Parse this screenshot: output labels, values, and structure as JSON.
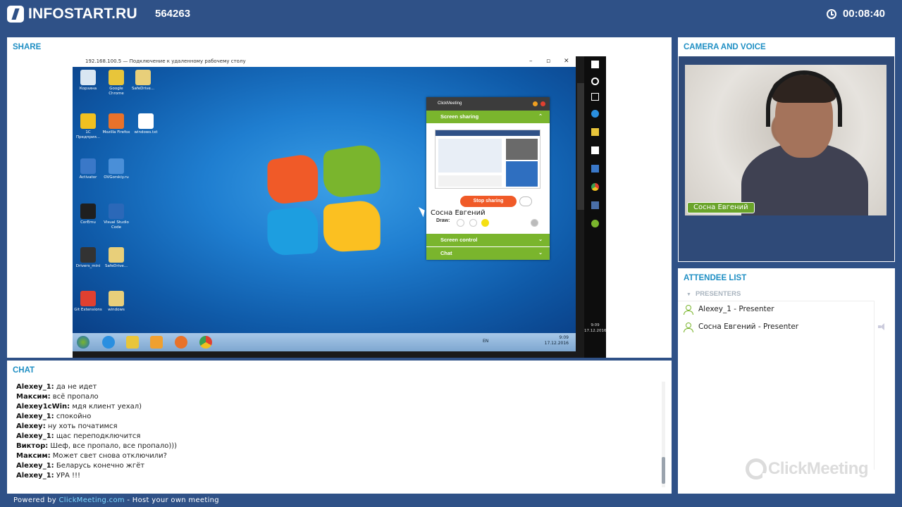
{
  "header": {
    "logo_text": "INFOSTART.RU",
    "meeting_id": "564263",
    "timer": "00:08:40"
  },
  "share": {
    "title": "SHARE",
    "remote_title": "192.168.100.5 — Подключение к удаленному рабочему столу",
    "desktop_icons": [
      {
        "label": "Корзина",
        "color": "#d9e6f2"
      },
      {
        "label": "Google Chrome",
        "color": "#e8c53a"
      },
      {
        "label": "SafeDrive...",
        "color": "#e8cf7a"
      },
      {
        "label": "1С Предприя...",
        "color": "#f0c020"
      },
      {
        "label": "Mozilla Firefox",
        "color": "#e8722a"
      },
      {
        "label": "windows.txt",
        "color": "#ffffff"
      },
      {
        "label": "Activator",
        "color": "#3a78c8"
      },
      {
        "label": "OVGorskiy.ru",
        "color": "#4a8fd8"
      },
      {
        "label": "CorEmu",
        "color": "#1f1f1f"
      },
      {
        "label": "Visual Studio Code",
        "color": "#2b68b8"
      },
      {
        "label": "Drivers_mini",
        "color": "#333333"
      },
      {
        "label": "SafeDrive...",
        "color": "#e8cf7a"
      },
      {
        "label": "Git Extensions",
        "color": "#e04030"
      },
      {
        "label": "windows",
        "color": "#e8cf7a"
      }
    ],
    "taskbar": {
      "lang": "EN",
      "time": "9:09",
      "date": "17.12.2016"
    },
    "win10": {
      "time": "9:09",
      "date": "17.12.2016"
    },
    "widget": {
      "brand": "ClickMeeting",
      "screen_sharing": "Screen sharing",
      "stop_sharing": "Stop sharing",
      "draw_label": "Draw:",
      "screen_control": "Screen control",
      "chat": "Chat"
    },
    "cursor_name": "Сосна Евгений"
  },
  "camera": {
    "title": "CAMERA AND VOICE",
    "name_label": "Сосна Евгений"
  },
  "attendees": {
    "title": "ATTENDEE LIST",
    "group": "PRESENTERS",
    "list": [
      {
        "name": "Alexey_1 - Presenter"
      },
      {
        "name": "Сосна Евгений - Presenter"
      }
    ],
    "watermark": "ClickMeeting"
  },
  "chat": {
    "title": "CHAT",
    "messages": [
      {
        "user": "Alexey_1:",
        "text": " да не идет"
      },
      {
        "user": "Максим:",
        "text": " всё пропало"
      },
      {
        "user": "Alexey1cWin:",
        "text": " мдя клиент уехал)"
      },
      {
        "user": "Alexey_1:",
        "text": " спокойно"
      },
      {
        "user": "Alexey:",
        "text": " ну хоть початимся"
      },
      {
        "user": "Alexey_1:",
        "text": " щас переподключится"
      },
      {
        "user": "Виктор:",
        "text": " Шеф, все пропало, все пропало)))"
      },
      {
        "user": "Максим:",
        "text": " Может свет снова отключили?"
      },
      {
        "user": "Alexey_1:",
        "text": " Беларусь конечно жгёт"
      },
      {
        "user": "Alexey_1:",
        "text": " УРА !!!"
      }
    ]
  },
  "footer": {
    "prefix": "Powered by ",
    "link": "ClickMeeting.com",
    "suffix": " - Host your own meeting"
  }
}
